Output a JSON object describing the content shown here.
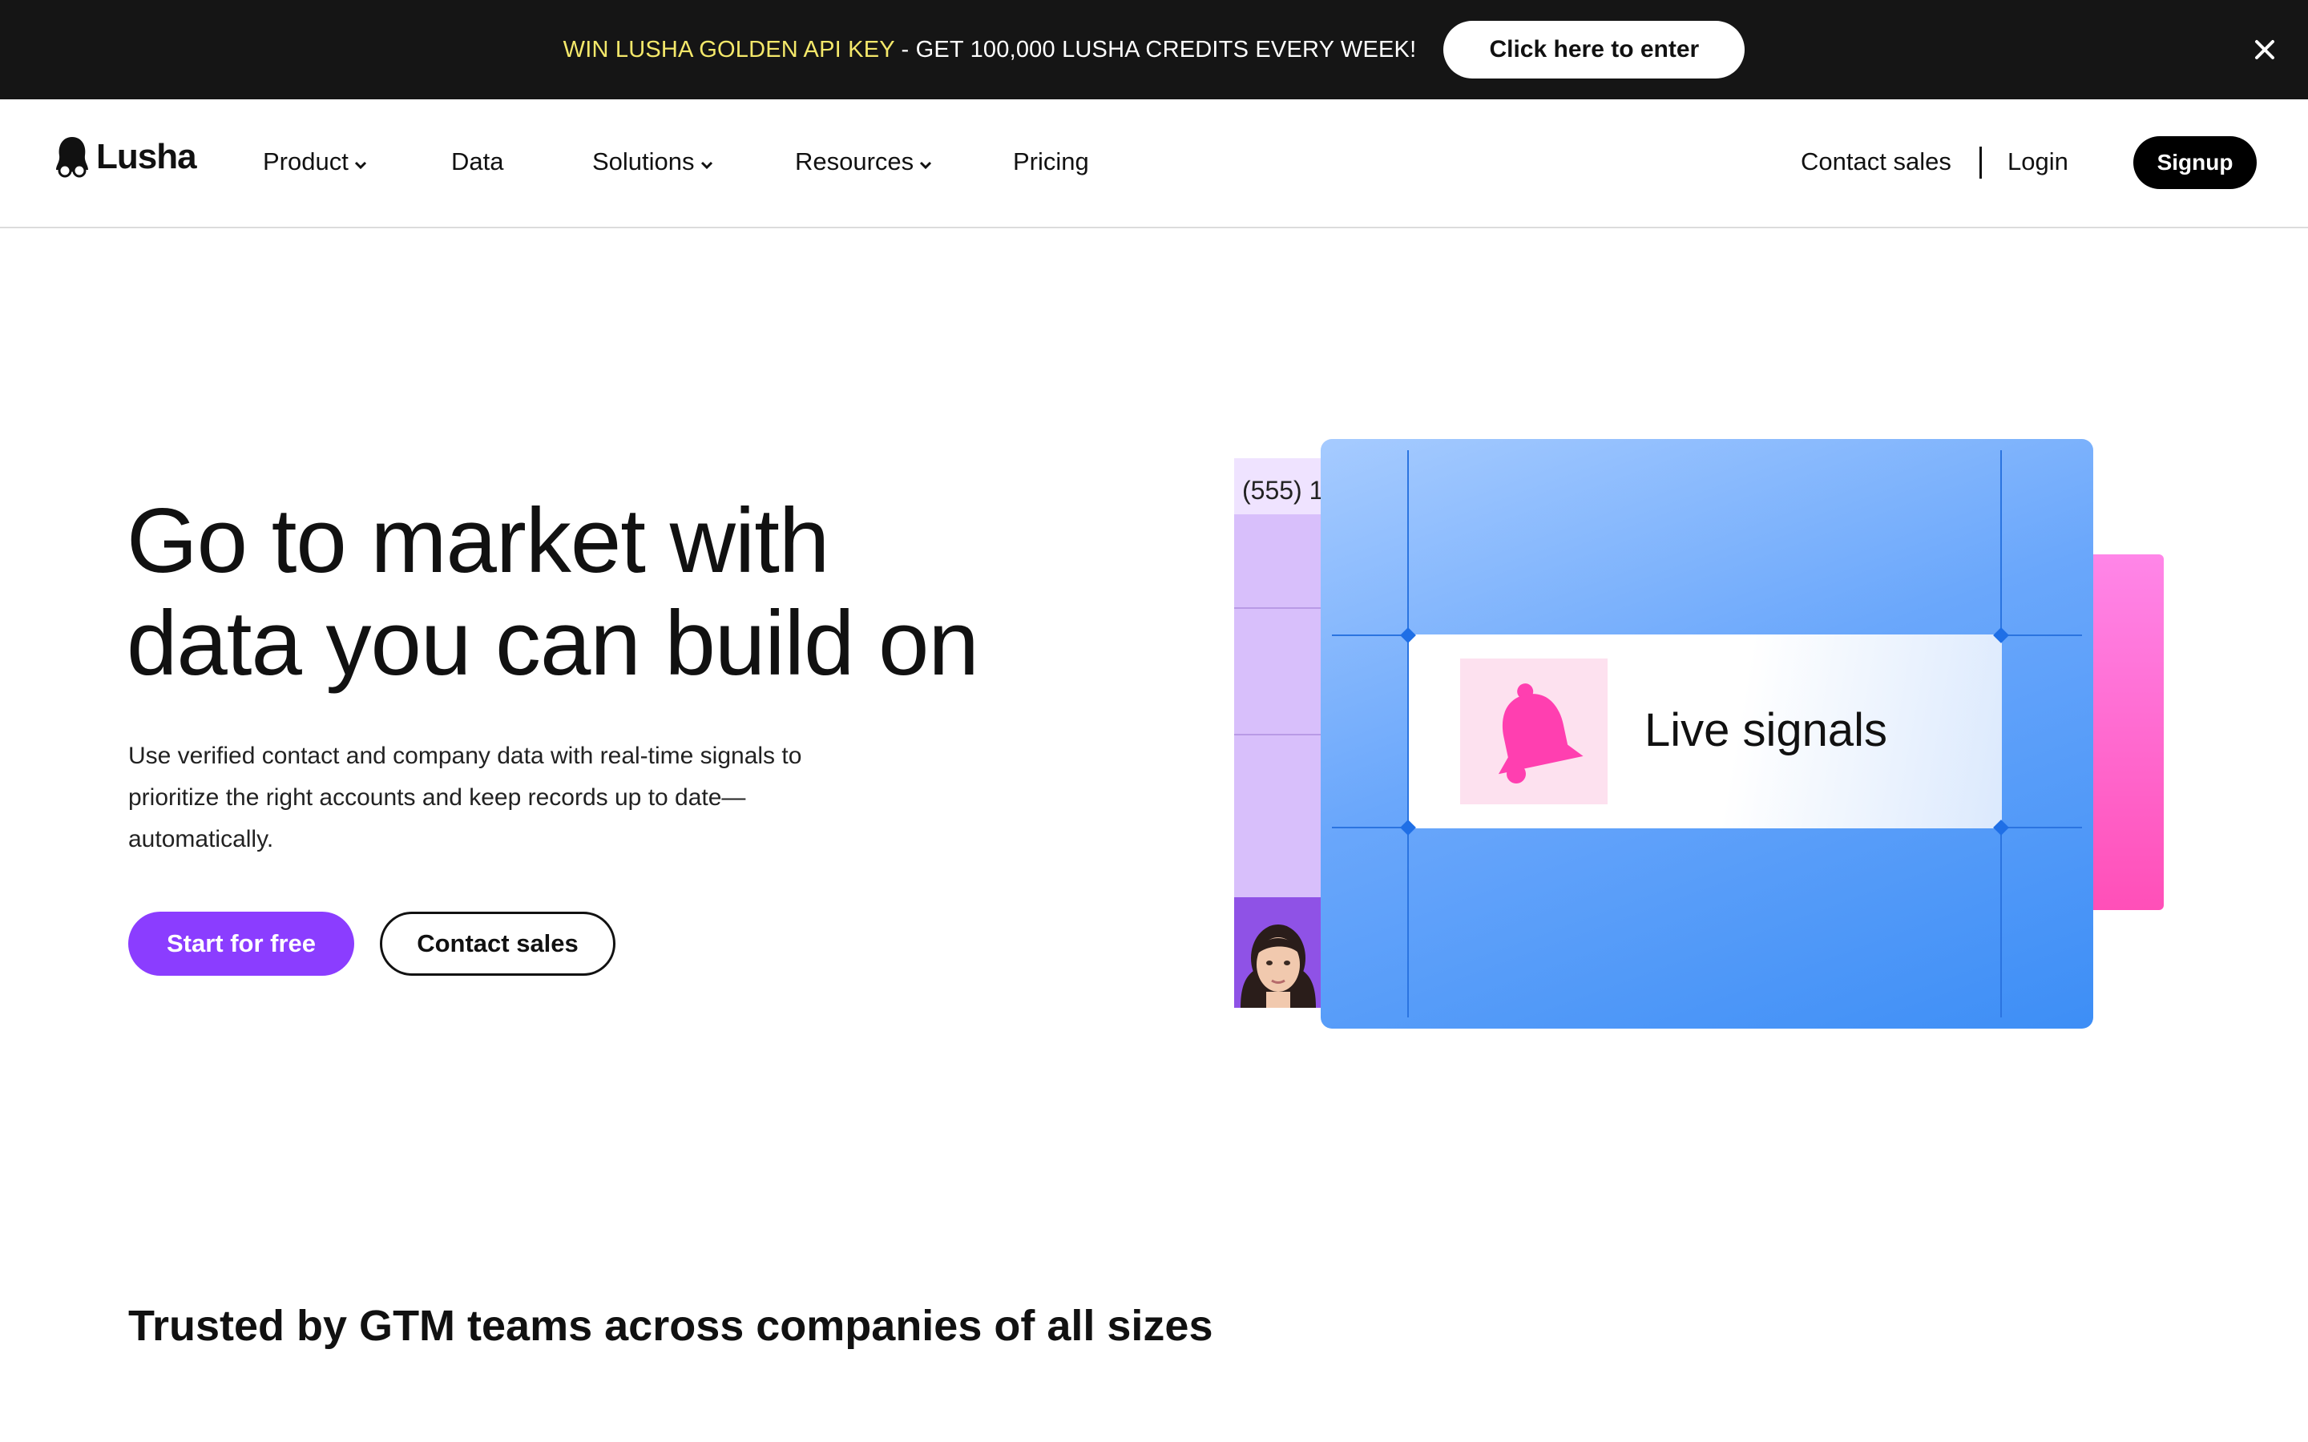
{
  "banner": {
    "highlight": "WIN LUSHA GOLDEN API KEY",
    "text": " - GET 100,000 LUSHA CREDITS EVERY WEEK!",
    "cta": "Click here to enter",
    "close_icon": "close-icon"
  },
  "header": {
    "logo_text": "Lusha",
    "nav": [
      {
        "label": "Product",
        "dropdown": true
      },
      {
        "label": "Data",
        "dropdown": false
      },
      {
        "label": "Solutions",
        "dropdown": true
      },
      {
        "label": "Resources",
        "dropdown": true
      },
      {
        "label": "Pricing",
        "dropdown": false
      }
    ],
    "contact_sales": "Contact sales",
    "login": "Login",
    "signup": "Signup"
  },
  "hero": {
    "title_line1": "Go to market with",
    "title_line2": "data you can build on",
    "subtitle_line1": "Use verified contact and company data with real-time signals to",
    "subtitle_line2": "prioritize the right accounts and keep records up to date—",
    "subtitle_line3": "automatically.",
    "primary_cta": "Start for free",
    "secondary_cta": "Contact sales"
  },
  "illustration": {
    "phone_snippet": "(555) 1",
    "signal_label": "Live signals",
    "icon": "bell-icon"
  },
  "trusted": {
    "heading": "Trusted by GTM teams across companies of all sizes"
  },
  "colors": {
    "banner_bg": "#151515",
    "banner_highlight": "#f4e86a",
    "primary": "#8b3dff",
    "card_blue": "#5c9ff9",
    "pink": "#ff4fb8"
  }
}
